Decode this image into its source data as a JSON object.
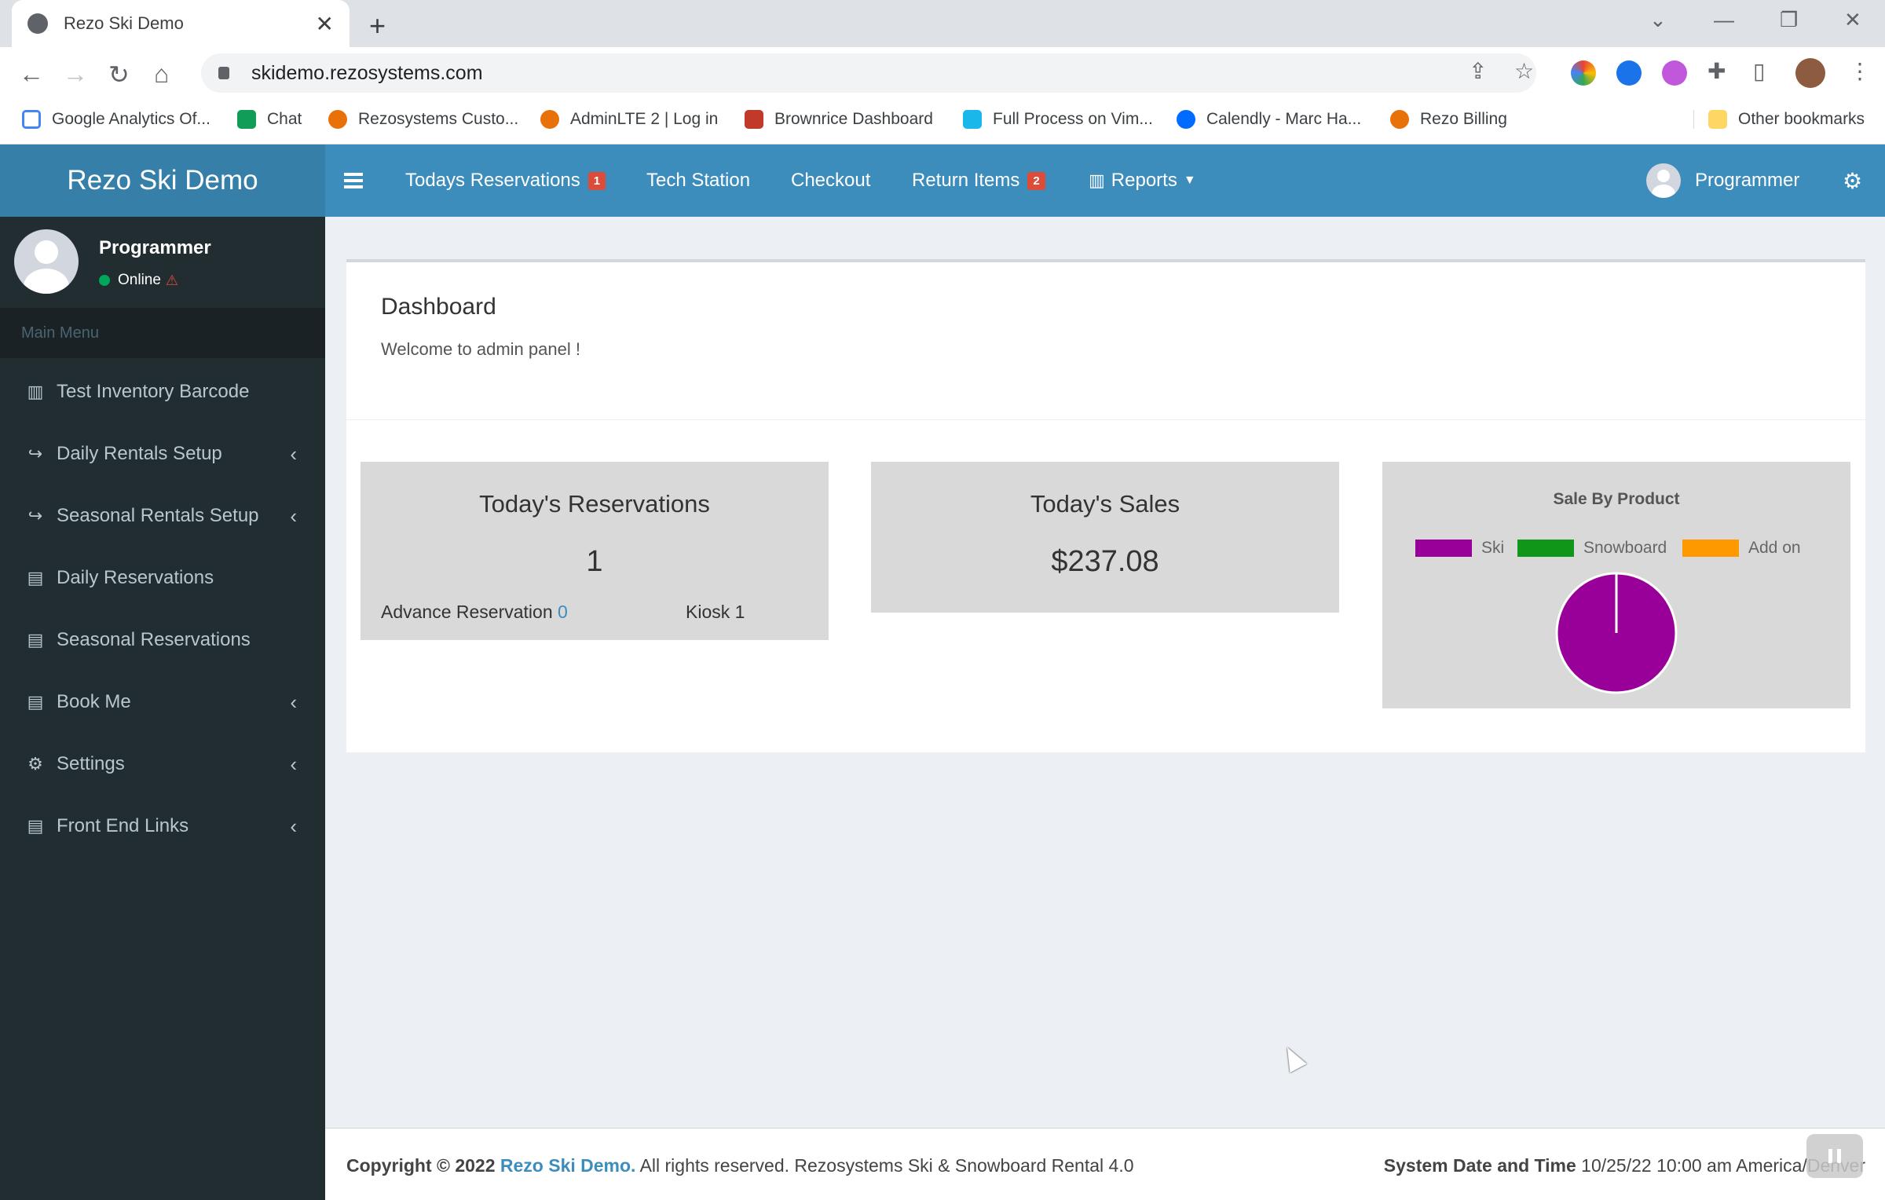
{
  "browser": {
    "tab_title": "Rezo Ski Demo",
    "url": "skidemo.rezosystems.com",
    "bookmarks": [
      {
        "label": "Google Analytics Of...",
        "color": "#4285f4"
      },
      {
        "label": "Chat",
        "color": "#0f9d58"
      },
      {
        "label": "Rezosystems Custo...",
        "color": "#e8710a"
      },
      {
        "label": "AdminLTE 2 | Log in",
        "color": "#e8710a"
      },
      {
        "label": "Brownrice Dashboard",
        "color": "#c0392b"
      },
      {
        "label": "Full Process on Vim...",
        "color": "#1ab7ea"
      },
      {
        "label": "Calendly - Marc Ha...",
        "color": "#006bff"
      },
      {
        "label": "Rezo Billing",
        "color": "#e8710a"
      }
    ],
    "other_bookmarks": "Other bookmarks"
  },
  "app": {
    "logo": "Rezo Ski Demo",
    "nav": {
      "todays_reservations": "Todays Reservations",
      "todays_reservations_badge": "1",
      "tech_station": "Tech Station",
      "checkout": "Checkout",
      "return_items": "Return Items",
      "return_items_badge": "2",
      "reports": "Reports",
      "user": "Programmer"
    }
  },
  "sidebar": {
    "user_name": "Programmer",
    "status": "Online",
    "menu_header": "Main Menu",
    "items": [
      {
        "label": "Test Inventory Barcode",
        "icon": "barcode-icon"
      },
      {
        "label": "Daily Rentals Setup",
        "icon": "share-icon"
      },
      {
        "label": "Seasonal Rentals Setup",
        "icon": "share-icon"
      },
      {
        "label": "Daily Reservations",
        "icon": "book-icon"
      },
      {
        "label": "Seasonal Reservations",
        "icon": "book-icon"
      },
      {
        "label": "Book Me",
        "icon": "book-icon"
      },
      {
        "label": "Settings",
        "icon": "cogs-icon"
      },
      {
        "label": "Front End Links",
        "icon": "book-icon"
      }
    ]
  },
  "dashboard": {
    "title": "Dashboard",
    "subtitle": "Welcome to admin panel !",
    "reservations": {
      "title": "Today's Reservations",
      "value": "1",
      "advance_label": "Advance Reservation",
      "advance_value": "0",
      "kiosk_label": "Kiosk 1"
    },
    "sales": {
      "title": "Today's Sales",
      "value": "$237.08"
    }
  },
  "chart_data": {
    "type": "pie",
    "title": "Sale By Product",
    "legend_placement": "top",
    "categories": [
      "Ski",
      "Snowboard",
      "Add on"
    ],
    "values": [
      100,
      0,
      0
    ],
    "colors": [
      "#990099",
      "#109618",
      "#ff9900"
    ]
  },
  "footer": {
    "copyright_prefix": "Copyright © 2022",
    "brand": "Rezo Ski Demo.",
    "rights": "All rights reserved. Rezosystems Ski & Snowboard Rental 4.0",
    "datetime_label": "System Date and Time",
    "datetime_value": "10/25/22 10:00 am America/Denver"
  }
}
